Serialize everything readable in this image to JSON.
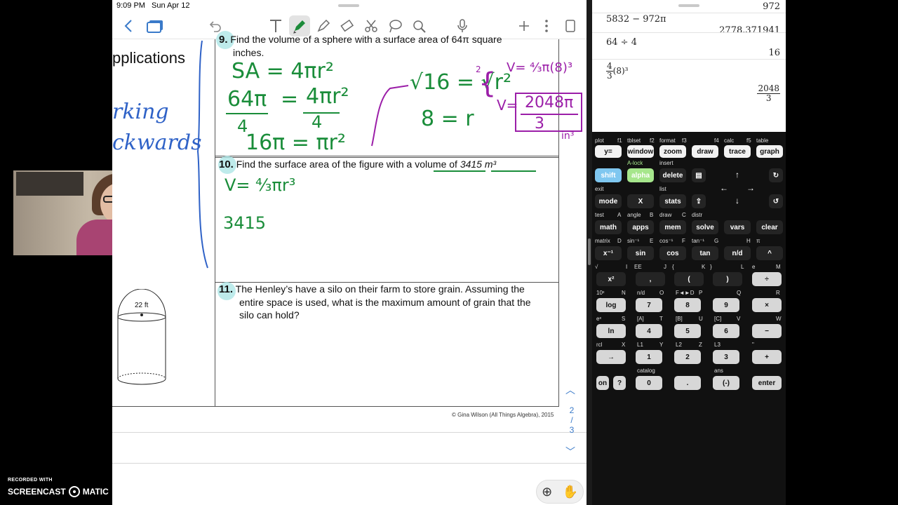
{
  "status_bar": {
    "time": "9:09 PM",
    "date": "Sun Apr 12"
  },
  "notes_toolbar": {
    "back_icon": "chevron-left-icon",
    "pages_icon": "pages-icon",
    "undo_icon": "undo-icon",
    "text_icon": "text-tool-icon",
    "pen_icon": "pen-icon",
    "highlighter_icon": "highlighter-icon",
    "eraser_icon": "eraser-icon",
    "scissors_icon": "scissors-icon",
    "shapes_icon": "lasso-icon",
    "tape_icon": "tape-icon",
    "mic_icon": "microphone-icon",
    "add_icon": "plus-icon",
    "more_icon": "more-icon",
    "export_icon": "page-icon"
  },
  "worksheet": {
    "section_title": "pplications",
    "side_words": [
      "rking",
      "ckwards"
    ],
    "q9": {
      "number": "9.",
      "text_line1": "Find the volume of a sphere with a surface area of 64π square",
      "text_line2": "inches."
    },
    "q10": {
      "number": "10.",
      "text": "Find the surface area of the figure with a volume of",
      "value": "3415 m³"
    },
    "q11": {
      "number": "11.",
      "text_line1": "The Henley’s have a silo on their farm to store grain.  Assuming the",
      "text_line2": "entire space is used, what is the maximum amount of grain that the",
      "text_line3": "silo can hold?"
    },
    "silo_label": "22 ft",
    "handwriting_q9": {
      "line1": "SA = 4πr²",
      "line2_num": "64π",
      "line2_eq": "=",
      "line2_rhs": "4πr²",
      "den1": "4",
      "den2": "4",
      "line3": "16π = πr²",
      "sqrt": "√16 = √r²",
      "solve": "8 = r",
      "volume_formula": "V= ⁴⁄₃π(8)³",
      "answer_lhs": "V=",
      "answer_num": "2048π",
      "answer_den": "3",
      "unit": "in³"
    },
    "handwriting_q10": {
      "formula": "V= ⁴⁄₃πr³",
      "value": "3415"
    },
    "footer": "© Gina Wilson (All Things Algebra), 2015",
    "page_indicator": {
      "current": "2",
      "sep": "/",
      "total": "3"
    }
  },
  "calculator": {
    "history": [
      {
        "expr": "",
        "result": "972"
      },
      {
        "expr": "5832 − 972π",
        "result": "2778.371941"
      },
      {
        "expr": "64 ÷ 4",
        "result": "16"
      },
      {
        "expr_num": "4",
        "expr_den": "3",
        "expr_tail": "(8)³",
        "result_num": "2048",
        "result_den": "3"
      }
    ],
    "row1_labels": [
      "plot",
      "f1",
      "tblset",
      "f2",
      "format",
      "f3",
      "f4",
      "calc",
      "f5",
      "table"
    ],
    "row1_keys": [
      "y=",
      "window",
      "zoom",
      "draw",
      "trace",
      "graph"
    ],
    "row2_labels": [
      "A-lock",
      "insert"
    ],
    "row2_keys": [
      "shift",
      "alpha",
      "delete"
    ],
    "row3_labels": [
      "exit",
      "list"
    ],
    "row3_keys": [
      "mode",
      "X",
      "stats"
    ],
    "row4_labels": [
      "test",
      "A",
      "angle",
      "B",
      "draw",
      "C",
      "distr"
    ],
    "row4_keys": [
      "math",
      "apps",
      "mem",
      "solve",
      "vars",
      "clear"
    ],
    "row5_labels": [
      "matrix",
      "D",
      "sin⁻¹",
      "E",
      "cos⁻¹",
      "F",
      "tan⁻¹",
      "G",
      "H",
      "π"
    ],
    "row5_keys": [
      "x⁻¹",
      "sin",
      "cos",
      "tan",
      "n/d",
      "^"
    ],
    "row6_labels": [
      "√",
      "I",
      "EE",
      "J",
      "{",
      "K",
      "}",
      "L",
      "e",
      "M"
    ],
    "row6_keys": [
      "x²",
      ",",
      "(",
      ")",
      "÷"
    ],
    "row7_labels": [
      "10ˣ",
      "N",
      "n/d",
      "O",
      "F◄►D",
      "P",
      "Q",
      "R"
    ],
    "row7_keys": [
      "log",
      "7",
      "8",
      "9",
      "×"
    ],
    "row8_labels": [
      "eˣ",
      "S",
      "[A]",
      "T",
      "[B]",
      "U",
      "[C]",
      "V",
      "W"
    ],
    "row8_keys": [
      "ln",
      "4",
      "5",
      "6",
      "−"
    ],
    "row9_labels": [
      "rcl",
      "X",
      "L1",
      "Y",
      "L2",
      "Z",
      "L3",
      "\""
    ],
    "row9_keys": [
      "→",
      "1",
      "2",
      "3",
      "+"
    ],
    "row10_labels": [
      "catalog",
      "ans"
    ],
    "row10_keys": [
      "on",
      "?",
      "0",
      ".",
      "(-)",
      "enter"
    ],
    "arrow_icons": [
      "arrow-up-icon",
      "arrow-left-icon",
      "arrow-right-icon",
      "arrow-down-icon"
    ]
  },
  "recorder": {
    "label": "RECORDED WITH",
    "brand_left": "SCREENCAST",
    "brand_right": "MATIC"
  }
}
